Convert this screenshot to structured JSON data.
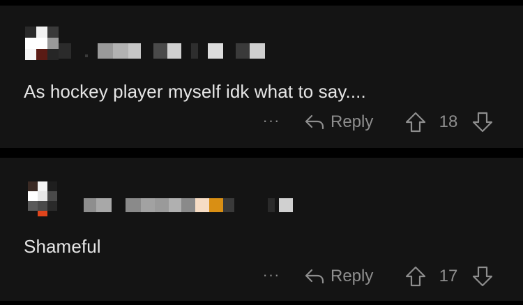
{
  "comments": [
    {
      "text": "As hockey player myself idk what to say....",
      "more_label": "···",
      "reply_label": "Reply",
      "score": "18"
    },
    {
      "text": "Shameful",
      "more_label": "···",
      "reply_label": "Reply",
      "score": "17"
    }
  ],
  "icons": {
    "reply": "reply-arrow-icon",
    "upvote": "arrow-up-outline-icon",
    "downvote": "arrow-down-outline-icon",
    "more": "ellipsis-icon"
  },
  "colors": {
    "background": "#000000",
    "card": "#141414",
    "text": "#e6e6e6",
    "muted": "#8e8e8e"
  }
}
